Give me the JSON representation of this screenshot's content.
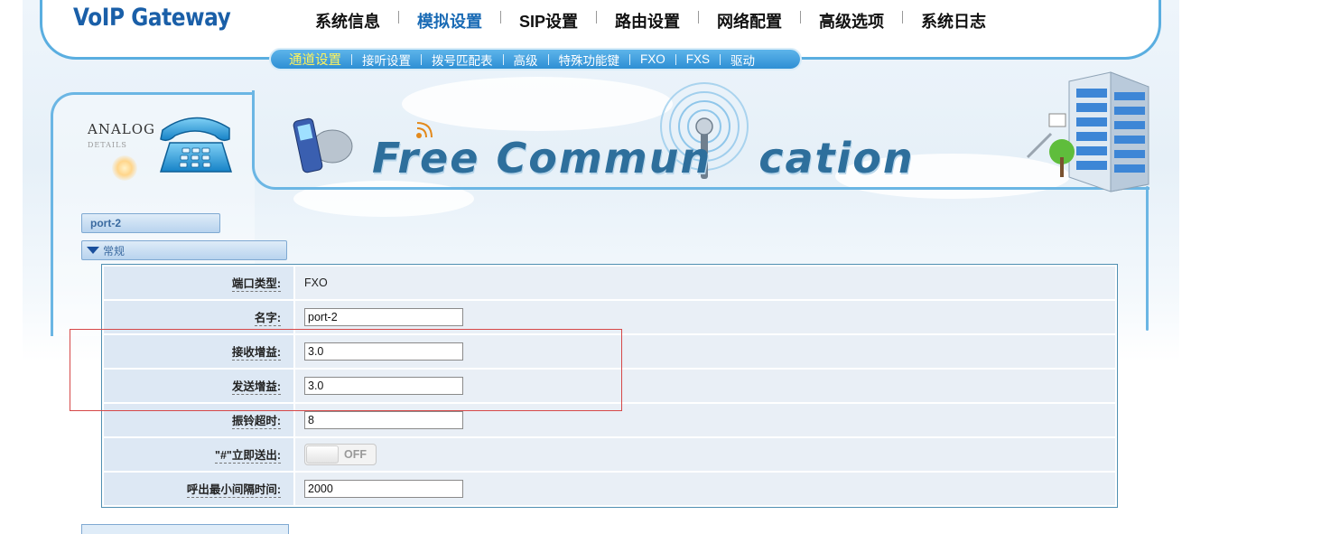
{
  "brand": "VoIP Gateway",
  "main_nav": [
    {
      "label": "系统信息",
      "active": false
    },
    {
      "label": "模拟设置",
      "active": true
    },
    {
      "label": "SIP设置",
      "active": false
    },
    {
      "label": "路由设置",
      "active": false
    },
    {
      "label": "网络配置",
      "active": false
    },
    {
      "label": "高级选项",
      "active": false
    },
    {
      "label": "系统日志",
      "active": false
    }
  ],
  "sub_nav": [
    {
      "label": "通道设置",
      "active": true
    },
    {
      "label": "接听设置",
      "active": false
    },
    {
      "label": "拨号匹配表",
      "active": false
    },
    {
      "label": "高级",
      "active": false
    },
    {
      "label": "特殊功能键",
      "active": false
    },
    {
      "label": "FXO",
      "active": false
    },
    {
      "label": "FXS",
      "active": false
    },
    {
      "label": "驱动",
      "active": false
    }
  ],
  "analog": {
    "title": "ANALOG",
    "subtitle": "DETAILS"
  },
  "banner": {
    "part1": "Free Commun",
    "part2": "cation"
  },
  "port_header": "port-2",
  "section_header": "常规",
  "fields": {
    "port_type": {
      "label": "端口类型:",
      "value": "FXO"
    },
    "name": {
      "label": "名字:",
      "value": "port-2"
    },
    "rx_gain": {
      "label": "接收增益:",
      "value": "3.0"
    },
    "tx_gain": {
      "label": "发送增益:",
      "value": "3.0"
    },
    "ring_timeout": {
      "label": "振铃超时:",
      "value": "8"
    },
    "hash_send": {
      "label": "\"#\"立即送出:",
      "value": "OFF"
    },
    "min_interval": {
      "label": "呼出最小间隔时间:",
      "value": "2000"
    }
  },
  "colors": {
    "accent": "#2e8fd4",
    "active_nav": "#1a6bb5",
    "active_sub": "#fff35a",
    "highlight_box": "#d64848"
  }
}
